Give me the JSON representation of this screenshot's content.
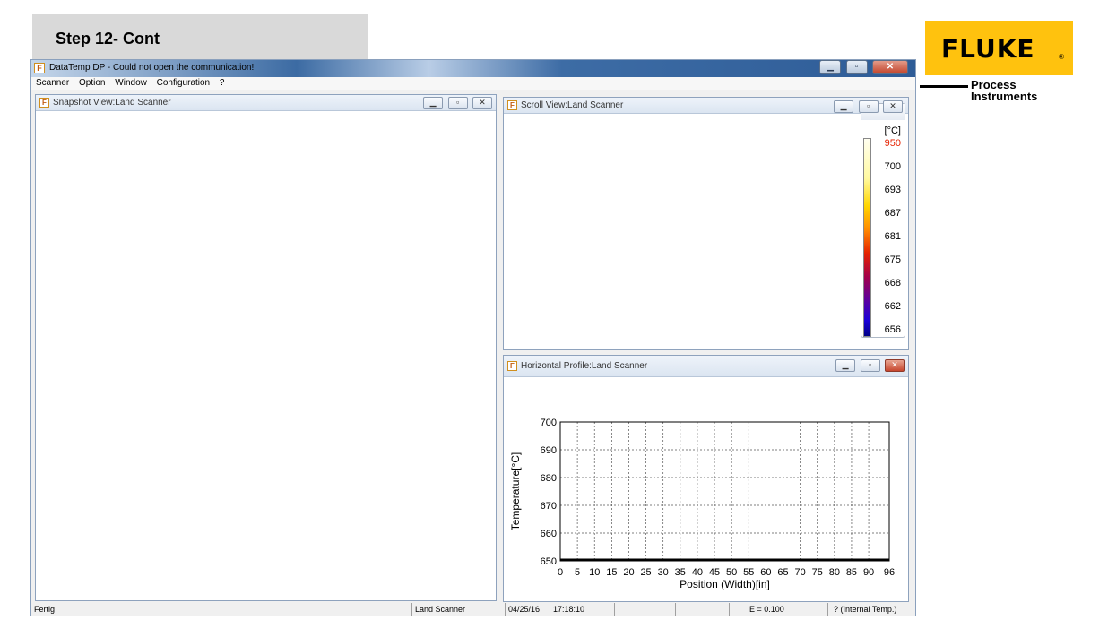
{
  "slide": {
    "step_title": "Step 12- Cont",
    "logo_text": "FLUKE",
    "logo_dot": "®",
    "logo_sub": "Process\nInstruments",
    "logo_color": "#ffc20e"
  },
  "app": {
    "title": "DataTemp DP - Could not open the communication!",
    "menu": [
      "Scanner",
      "Option",
      "Window",
      "Configuration",
      "?"
    ],
    "app_icon": "app-icon"
  },
  "snapshot_view": {
    "title": "Snapshot View:Land Scanner"
  },
  "scroll_view": {
    "title": "Scroll View:Land Scanner",
    "scale_unit": "[°C]",
    "scale_labels": [
      "950",
      "700",
      "693",
      "687",
      "681",
      "675",
      "668",
      "662",
      "656"
    ],
    "top_label_color": "#e52200"
  },
  "profile_view": {
    "title": "Horizontal Profile:Land Scanner"
  },
  "chart_data": {
    "type": "line",
    "title": "",
    "xlabel": "Position (Width)[in]",
    "ylabel": "Temperature[°C]",
    "xlim": [
      0,
      96
    ],
    "ylim": [
      650,
      700
    ],
    "x_ticks": [
      "0",
      "5",
      "10",
      "15",
      "20",
      "25",
      "30",
      "35",
      "40",
      "45",
      "50",
      "55",
      "60",
      "65",
      "70",
      "75",
      "80",
      "85",
      "90",
      "96"
    ],
    "y_ticks": [
      "700",
      "690",
      "680",
      "670",
      "660",
      "650"
    ],
    "grid": true,
    "series": [
      {
        "x": [
          0,
          96
        ],
        "y": [
          650,
          650
        ]
      }
    ]
  },
  "status": {
    "left": "Fertig",
    "device": "Land Scanner",
    "date": "04/25/16",
    "time": "17:18:10",
    "empty1": "",
    "empty2": "",
    "emissivity": "E = 0.100",
    "internal": "? (Internal Temp.)"
  }
}
